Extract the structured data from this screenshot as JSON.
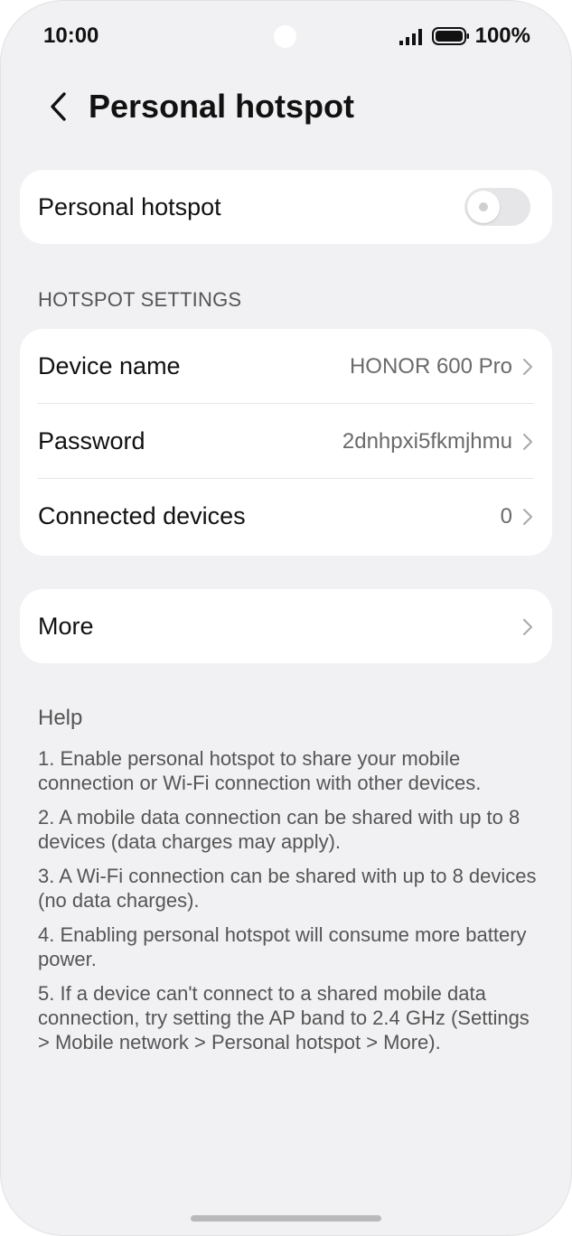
{
  "status_bar": {
    "time": "10:00",
    "battery": "100%",
    "icons": [
      "signal-icon",
      "battery-icon"
    ]
  },
  "header": {
    "back_icon": "chevron-left-icon",
    "title": "Personal hotspot"
  },
  "hotspot_toggle": {
    "label": "Personal hotspot",
    "enabled": false
  },
  "settings_section": {
    "header": "HOTSPOT SETTINGS",
    "rows": [
      {
        "label": "Device name",
        "value": "HONOR 600 Pro"
      },
      {
        "label": "Password",
        "value": "2dnhpxi5fkmjhmu"
      },
      {
        "label": "Connected devices",
        "value": "0"
      }
    ]
  },
  "more": {
    "label": "More"
  },
  "help": {
    "title": "Help",
    "items": [
      "1. Enable personal hotspot to share your mobile connection or Wi-Fi connection with other devices.",
      "2. A mobile data connection can be shared with up to 8 devices (data charges may apply).",
      "3. A Wi-Fi connection can be shared with up to 8 devices (no data charges).",
      "4. Enabling personal hotspot will consume more battery power.",
      "5. If a device can't connect to a shared mobile data connection, try setting the AP band to 2.4 GHz (Settings > Mobile network > Personal hotspot > More)."
    ]
  },
  "colors": {
    "background": "#f1f1f3",
    "card": "#ffffff",
    "text_primary": "#111111",
    "text_secondary": "#6a6a6a",
    "switch_off": "#e6e6e8"
  }
}
